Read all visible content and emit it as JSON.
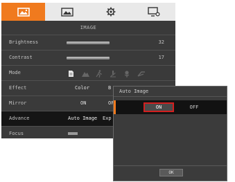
{
  "tabs": [
    {
      "icon": "image-icon",
      "active": true
    },
    {
      "icon": "picture-frame-icon",
      "active": false
    },
    {
      "icon": "gear-icon",
      "active": false
    },
    {
      "icon": "monitor-settings-icon",
      "active": false
    }
  ],
  "section_title": "IMAGE",
  "rows": {
    "brightness": {
      "label": "Brightness",
      "value": "32"
    },
    "contrast": {
      "label": "Contrast",
      "value": "17"
    },
    "mode": {
      "label": "Mode",
      "icons": [
        "document-icon",
        "mountain-icon",
        "runner-icon",
        "microscope-icon",
        "flower-icon",
        "lines-icon"
      ]
    },
    "effect": {
      "label": "Effect",
      "value": "Color",
      "next": "B"
    },
    "mirror": {
      "label": "Mirror",
      "on": "ON",
      "off": "OF"
    },
    "advance": {
      "label": "Advance",
      "value": "Auto Image",
      "next": "Exp"
    },
    "focus": {
      "label": "Focus"
    }
  },
  "dialog": {
    "title": "Auto Image",
    "on_label": "ON",
    "off_label": "OFF",
    "ok_label": "OK"
  },
  "colors": {
    "accent": "#f07a1e",
    "selection_border": "#d31f1f",
    "menu_bg": "#3a3a3a",
    "tab_bar": "#e9e9e9"
  }
}
